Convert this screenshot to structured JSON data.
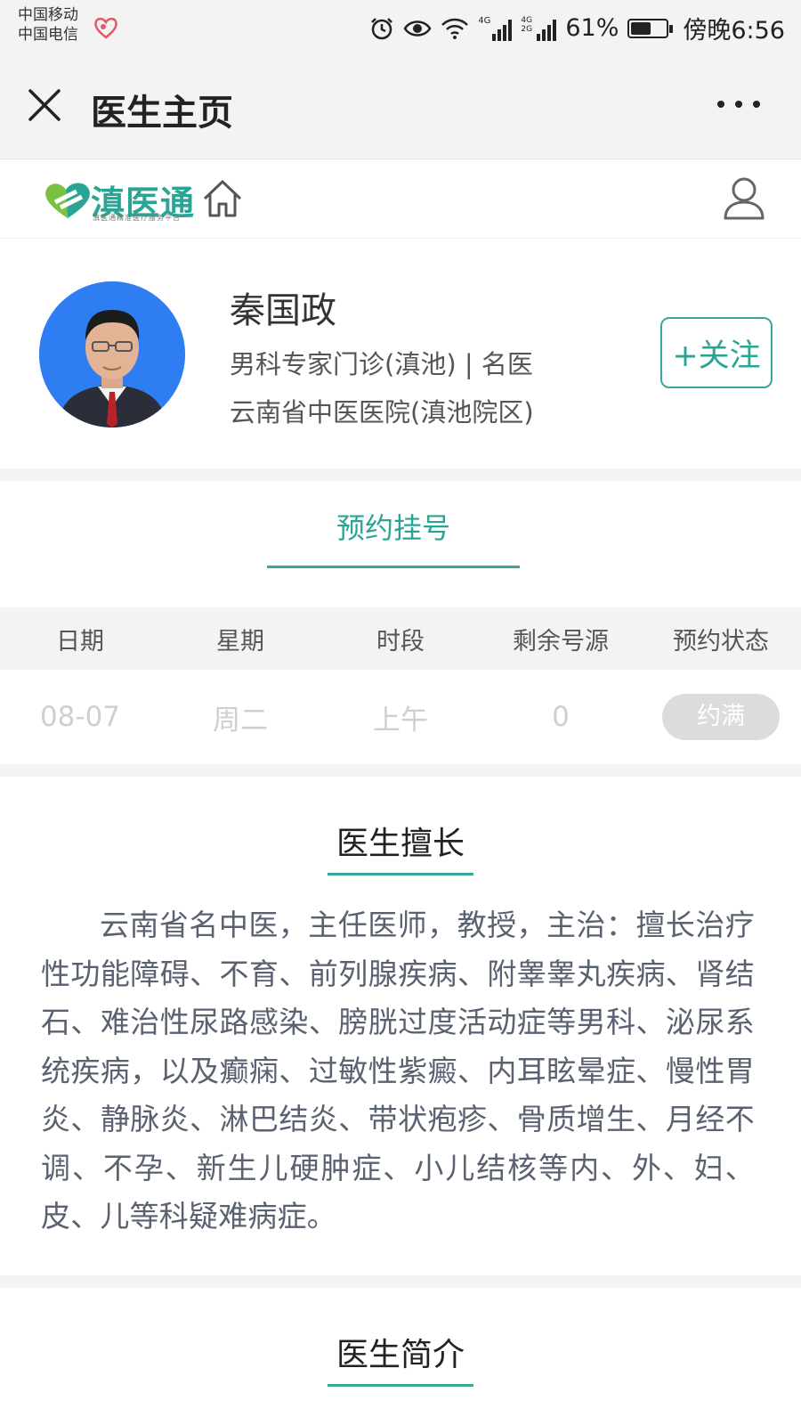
{
  "status_bar": {
    "carrier1": "中国移动",
    "carrier2": "中国电信",
    "net1": "4G",
    "net2": "4G 2G",
    "battery_text": "61%",
    "battery_level": 0.61,
    "time": "傍晚6:56"
  },
  "titlebar": {
    "title": "医生主页"
  },
  "app": {
    "logo_text": "滇医通",
    "logo_sub": "滇医通精准医疗服务平台"
  },
  "doctor": {
    "name": "秦国政",
    "dept_line": "男科专家门诊(滇池) | 名医",
    "hospital": "云南省中医医院(滇池院区)",
    "follow_label": "+关注"
  },
  "booking": {
    "tab_label": "预约挂号",
    "columns": [
      "日期",
      "星期",
      "时段",
      "剩余号源",
      "预约状态"
    ],
    "rows": [
      {
        "date": "08-07",
        "weekday": "周二",
        "period": "上午",
        "remaining": "0",
        "status": "约满"
      }
    ]
  },
  "specialty": {
    "title": "医生擅长",
    "text": "云南省名中医，主任医师，教授，主治：擅长治疗性功能障碍、不育、前列腺疾病、附睾睾丸疾病、肾结石、难治性尿路感染、膀胱过度活动症等男科、泌尿系统疾病，以及癫痫、过敏性紫癜、内耳眩晕症、慢性胃炎、静脉炎、淋巴结炎、带状疱疹、骨质增生、月经不调、不孕、新生儿硬肿症、小儿结核等内、外、妇、皮、儿等科疑难病症。"
  },
  "intro": {
    "title": "医生简介"
  },
  "colors": {
    "accent": "#38a89d",
    "avatar_bg": "#2e7df2"
  }
}
